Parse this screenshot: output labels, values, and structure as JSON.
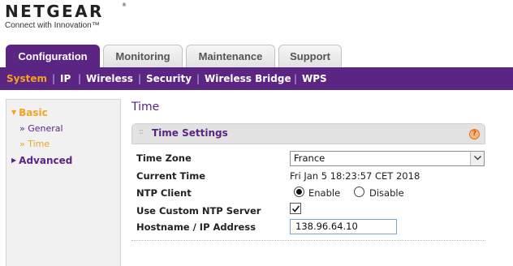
{
  "brand": {
    "name": "NETGEAR",
    "reg": "®",
    "tagline": "Connect with Innovation™"
  },
  "main_tabs": [
    {
      "label": "Configuration",
      "active": true
    },
    {
      "label": "Monitoring",
      "active": false
    },
    {
      "label": "Maintenance",
      "active": false
    },
    {
      "label": "Support",
      "active": false
    }
  ],
  "subnav": {
    "items": [
      {
        "label": "System",
        "active": true
      },
      {
        "label": "IP",
        "active": false
      },
      {
        "label": "Wireless",
        "active": false
      },
      {
        "label": "Security",
        "active": false
      },
      {
        "label": "Wireless Bridge",
        "active": false
      },
      {
        "label": "WPS",
        "active": false
      }
    ],
    "separator": "|"
  },
  "sidebar": {
    "expand_icon": "chevron-down-icon",
    "collapse_icon": "chevron-right-icon",
    "sections": [
      {
        "label": "Basic",
        "expanded": true,
        "items": [
          {
            "label": "» General",
            "active": false
          },
          {
            "label": "» Time",
            "active": true
          }
        ]
      },
      {
        "label": "Advanced",
        "expanded": false
      }
    ]
  },
  "main": {
    "title": "Time",
    "panel": {
      "title": "Time Settings",
      "grip": "::",
      "help_label": "?",
      "fields": {
        "time_zone": {
          "label": "Time Zone",
          "value": "France"
        },
        "current_time": {
          "label": "Current Time",
          "value": "Fri Jan 5 18:23:57 CET 2018"
        },
        "ntp_client": {
          "label": "NTP Client",
          "options": [
            "Enable",
            "Disable"
          ],
          "selected": "Enable"
        },
        "custom_ntp": {
          "label": "Use Custom NTP Server",
          "checked": true
        },
        "hostname": {
          "label": "Hostname / IP Address",
          "value": "138.96.64.10"
        }
      }
    }
  },
  "colors": {
    "brand_purple": "#5b2583",
    "accent_orange": "#f4a320",
    "panel_header": "#e2e2e2"
  }
}
